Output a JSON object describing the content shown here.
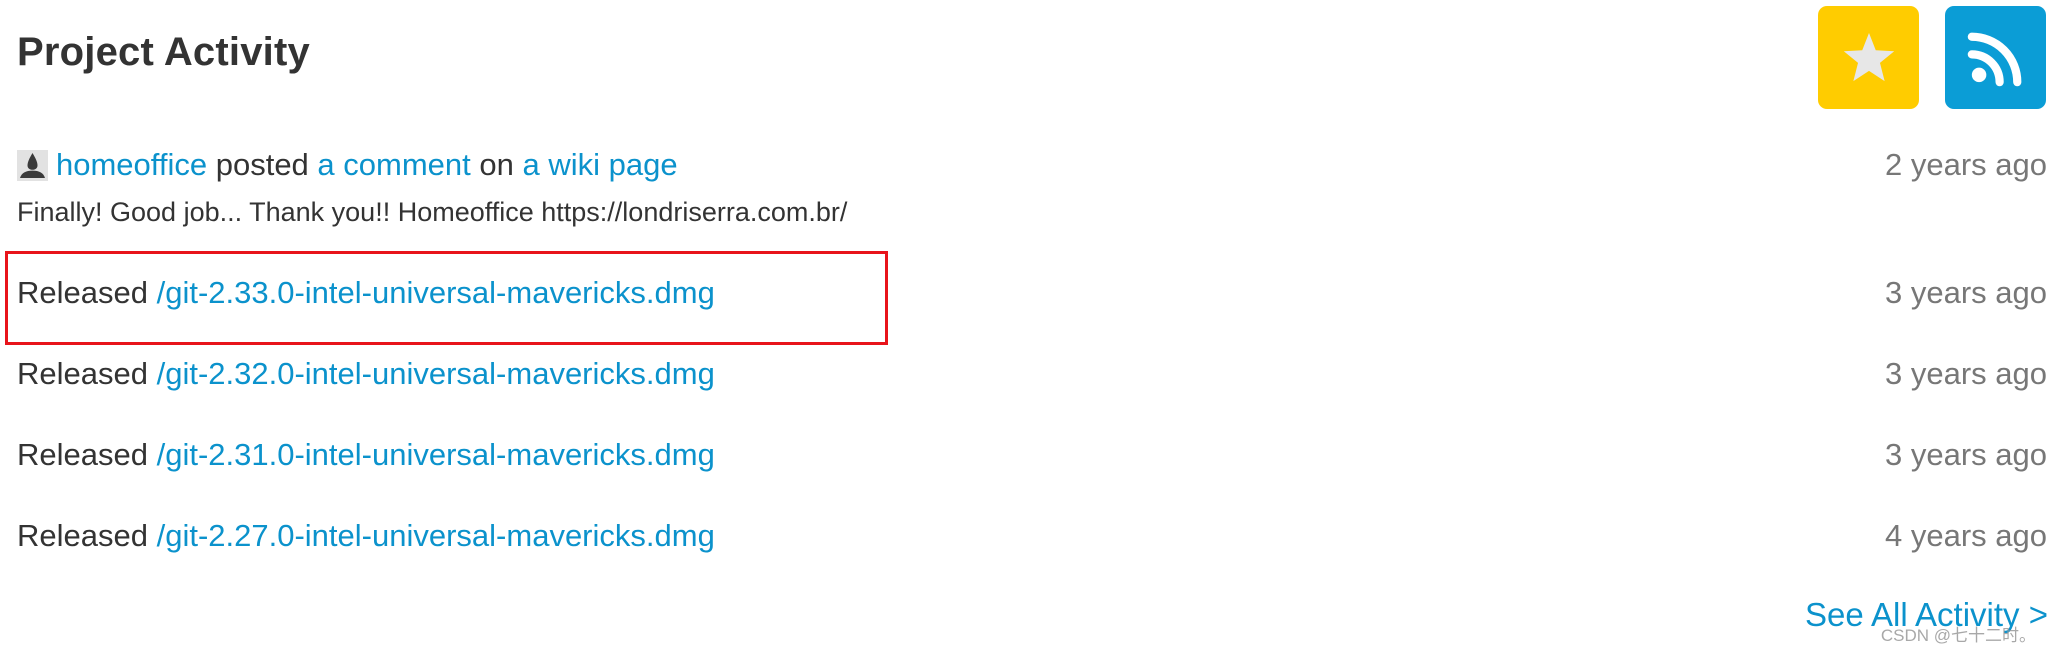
{
  "header": {
    "title": "Project Activity",
    "star_icon": "star-icon",
    "feed_icon": "rss-feed-icon",
    "colors": {
      "star_bg": "#ffcc00",
      "feed_bg": "#0b9dd6"
    }
  },
  "activities": [
    {
      "type": "comment",
      "avatar_icon": "user-avatar-icon",
      "user": "homeoffice",
      "verb": "posted",
      "object": "a comment",
      "preposition": "on",
      "target": "a wiki page",
      "body": "Finally! Good job... Thank you!! Homeoffice https://londriserra.com.br/",
      "time": "2 years ago"
    },
    {
      "type": "release",
      "label": "Released",
      "file": "/git-2.33.0-intel-universal-mavericks.dmg",
      "time": "3 years ago",
      "highlighted": true
    },
    {
      "type": "release",
      "label": "Released",
      "file": "/git-2.32.0-intel-universal-mavericks.dmg",
      "time": "3 years ago"
    },
    {
      "type": "release",
      "label": "Released",
      "file": "/git-2.31.0-intel-universal-mavericks.dmg",
      "time": "3 years ago"
    },
    {
      "type": "release",
      "label": "Released",
      "file": "/git-2.27.0-intel-universal-mavericks.dmg",
      "time": "4 years ago"
    }
  ],
  "footer": {
    "see_all": "See All Activity >",
    "watermark": "CSDN @七十二时。"
  },
  "colors": {
    "link": "#0b92cc",
    "text": "#333333",
    "muted": "#777777",
    "highlight": "#e8141b"
  }
}
